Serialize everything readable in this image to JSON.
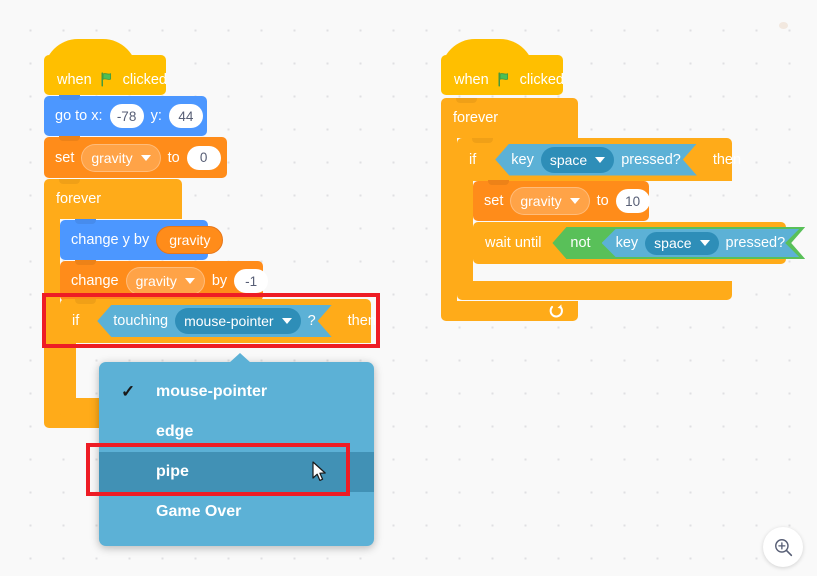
{
  "canvas": {
    "background_color": "#f9f9f9",
    "grid_dot_color": "#e0e0e2"
  },
  "palette": {
    "events": "#FFBF00",
    "motion": "#4C97FF",
    "variables": "#FF8C1A",
    "control": "#FFAB19",
    "sensing": "#5CB1D6",
    "operators": "#59C059",
    "annotation_red": "#EE1C25",
    "menu_background": "#5CB1D6",
    "menu_hover": "#4191B5"
  },
  "scripts": {
    "script_one": {
      "hat": {
        "when": "when",
        "flag_icon": "green-flag-icon",
        "clicked": "clicked"
      },
      "go_to": {
        "label_x": "go to x:",
        "value_x": "-78",
        "label_y": "y:",
        "value_y": "44"
      },
      "set_gravity": {
        "verb": "set",
        "variable": "gravity",
        "to": "to",
        "value": "0"
      },
      "forever": {
        "label": "forever"
      },
      "change_y": {
        "label": "change y by",
        "reporter": "gravity"
      },
      "change_gravity": {
        "verb": "change",
        "variable": "gravity",
        "by": "by",
        "value": "-1"
      },
      "if_touching": {
        "if": "if",
        "touching": "touching",
        "target": "mouse-pointer",
        "question": "?",
        "then": "then"
      }
    },
    "script_two": {
      "hat": {
        "when": "when",
        "flag_icon": "green-flag-icon",
        "clicked": "clicked"
      },
      "forever": {
        "label": "forever"
      },
      "if_key": {
        "if": "if",
        "key": "key",
        "key_name": "space",
        "pressed": "pressed?",
        "then": "then"
      },
      "set_gravity": {
        "verb": "set",
        "variable": "gravity",
        "to": "to",
        "value": "10"
      },
      "wait_until": {
        "label": "wait until",
        "not": "not",
        "key": "key",
        "key_name": "space",
        "pressed": "pressed?"
      }
    }
  },
  "dropdown": {
    "open": true,
    "selected": "mouse-pointer",
    "hovered": "pipe",
    "items": [
      {
        "label": "mouse-pointer",
        "checked": true,
        "hovered": false
      },
      {
        "label": "edge",
        "checked": false,
        "hovered": false
      },
      {
        "label": "pipe",
        "checked": false,
        "hovered": true
      },
      {
        "label": "Game Over",
        "checked": false,
        "hovered": false
      }
    ]
  },
  "annotations": [
    {
      "name": "if-touching-block-highlight",
      "target": "if touching mouse-pointer ? then"
    },
    {
      "name": "pipe-menu-item-highlight",
      "target": "pipe"
    }
  ],
  "zoom_control": {
    "zoom_in_label": "zoom-in-icon"
  }
}
